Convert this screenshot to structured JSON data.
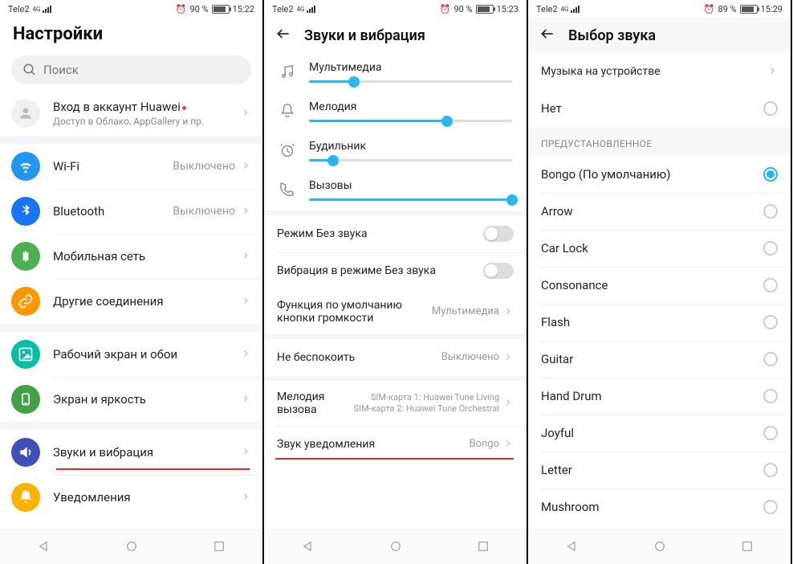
{
  "s1": {
    "status": {
      "carrier": "Tele2",
      "net": "4G",
      "battery": "90 %",
      "time": "15:22",
      "alarm": true
    },
    "title": "Настройки",
    "search_placeholder": "Поиск",
    "account": {
      "title": "Вход в аккаунт Huawei",
      "sub": "Доступ в Облако, AppGallery и пр."
    },
    "items": [
      {
        "label": "Wi-Fi",
        "value": "Выключено",
        "icon": "wifi",
        "color": "ic-blue"
      },
      {
        "label": "Bluetooth",
        "value": "Выключено",
        "icon": "bluetooth",
        "color": "ic-blue2"
      },
      {
        "label": "Мобильная сеть",
        "value": "",
        "icon": "mobile",
        "color": "ic-green"
      },
      {
        "label": "Другие соединения",
        "value": "",
        "icon": "link",
        "color": "ic-orange"
      },
      {
        "label": "Рабочий экран и обои",
        "value": "",
        "icon": "image",
        "color": "ic-teal"
      },
      {
        "label": "Экран и яркость",
        "value": "",
        "icon": "brightness",
        "color": "ic-green2"
      },
      {
        "label": "Звуки и вибрация",
        "value": "",
        "icon": "sound",
        "color": "ic-indigo",
        "underline": true
      },
      {
        "label": "Уведомления",
        "value": "",
        "icon": "bell",
        "color": "ic-amber"
      }
    ]
  },
  "s2": {
    "status": {
      "carrier": "Tele2",
      "net": "4G",
      "battery": "90 %",
      "time": "15:23",
      "alarm": true
    },
    "title": "Звуки и вибрация",
    "sliders": [
      {
        "label": "Мультимедиа",
        "icon": "music",
        "value": 22
      },
      {
        "label": "Мелодия",
        "icon": "bell2",
        "value": 68
      },
      {
        "label": "Будильник",
        "icon": "alarm",
        "value": 12
      },
      {
        "label": "Вызовы",
        "icon": "phone",
        "value": 100
      }
    ],
    "toggles": [
      {
        "label": "Режим Без звука",
        "on": false
      },
      {
        "label": "Вибрация в режиме Без звука",
        "on": false
      }
    ],
    "vol_default": {
      "label": "Функция по умолчанию кнопки громкости",
      "value": "Мультимедиа"
    },
    "dnd": {
      "label": "Не беспокоить",
      "value": "Выключено"
    },
    "ringtone": {
      "label": "Мелодия вызова",
      "value": "SIM-карта 1: Huawei Tune Living\nSIM-карта 2: Huawei Tune Orchestral"
    },
    "notif_sound": {
      "label": "Звук уведомления",
      "value": "Bongo",
      "underline": true
    }
  },
  "s3": {
    "status": {
      "carrier": "Tele2",
      "net": "4G",
      "battery": "89 %",
      "time": "15:29",
      "alarm": true
    },
    "title": "Выбор звука",
    "music_on_device": "Музыка на устройстве",
    "none": "Нет",
    "preset_header": "ПРЕДУСТАНОВЛЕННОЕ",
    "sounds": [
      {
        "label": "Bongo (По умолчанию)",
        "selected": true
      },
      {
        "label": "Arrow",
        "selected": false
      },
      {
        "label": "Car Lock",
        "selected": false
      },
      {
        "label": "Consonance",
        "selected": false
      },
      {
        "label": "Flash",
        "selected": false
      },
      {
        "label": "Guitar",
        "selected": false
      },
      {
        "label": "Hand Drum",
        "selected": false
      },
      {
        "label": "Joyful",
        "selected": false
      },
      {
        "label": "Letter",
        "selected": false
      },
      {
        "label": "Mushroom",
        "selected": false
      }
    ]
  }
}
